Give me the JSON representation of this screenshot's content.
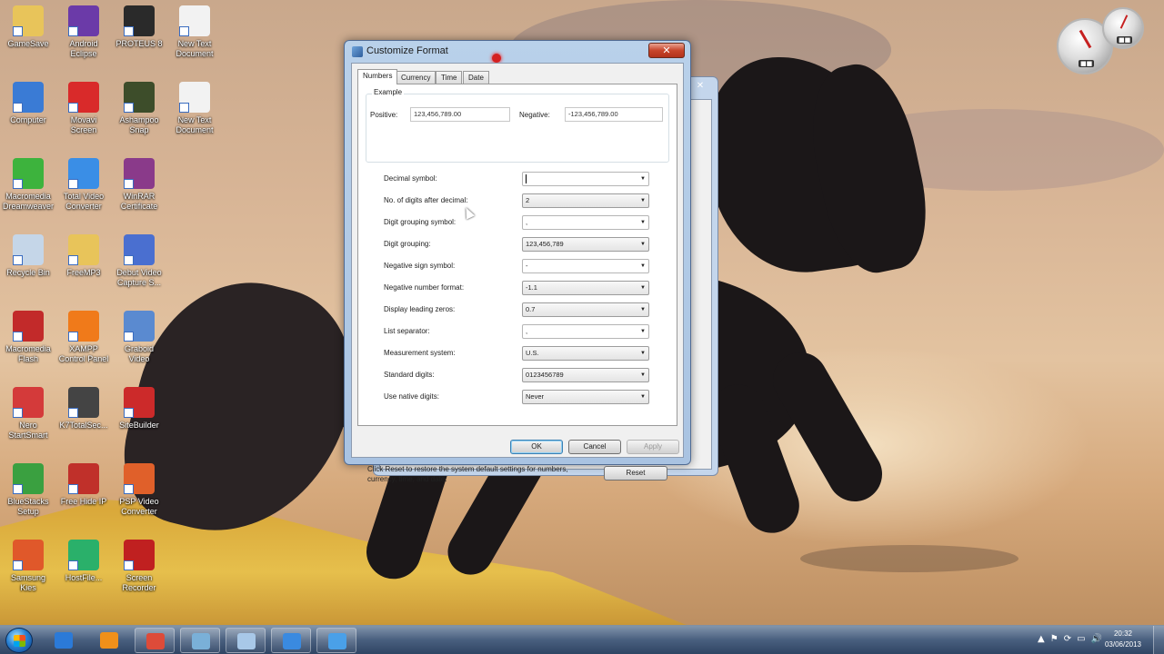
{
  "dialog": {
    "title": "Customize Format",
    "close_label": "✕",
    "tabs": [
      {
        "label": "Numbers"
      },
      {
        "label": "Currency"
      },
      {
        "label": "Time"
      },
      {
        "label": "Date"
      }
    ],
    "example": {
      "group_title": "Example",
      "positive_label": "Positive:",
      "positive_value": "123,456,789.00",
      "negative_label": "Negative:",
      "negative_value": "-123,456,789.00"
    },
    "fields": [
      {
        "label": "Decimal symbol:",
        "value": ""
      },
      {
        "label": "No. of digits after decimal:",
        "value": "2"
      },
      {
        "label": "Digit grouping symbol:",
        "value": ","
      },
      {
        "label": "Digit grouping:",
        "value": "123,456,789"
      },
      {
        "label": "Negative sign symbol:",
        "value": "-"
      },
      {
        "label": "Negative number format:",
        "value": "-1.1"
      },
      {
        "label": "Display leading zeros:",
        "value": "0.7"
      },
      {
        "label": "List separator:",
        "value": ","
      },
      {
        "label": "Measurement system:",
        "value": "U.S."
      },
      {
        "label": "Standard digits:",
        "value": "0123456789"
      },
      {
        "label": "Use native digits:",
        "value": "Never"
      }
    ],
    "reset_note": "Click Reset to restore the system default settings for numbers, currency, time, and date.",
    "reset_label": "Reset",
    "ok_label": "OK",
    "cancel_label": "Cancel",
    "apply_label": "Apply"
  },
  "desktop_icons": [
    {
      "label": "GameSave",
      "icon": "folder-icon",
      "color": "#e8c45a"
    },
    {
      "label": "Android\nEclipse",
      "icon": "eclipse-icon",
      "color": "#6b3aa8"
    },
    {
      "label": "PROTEUS 8",
      "icon": "proteus-icon",
      "color": "#2a2a2a"
    },
    {
      "label": "New Text\nDocument",
      "icon": "text-document-icon",
      "color": "#f2f2f2"
    },
    {
      "label": "Computer",
      "icon": "computer-icon",
      "color": "#3a7bd5"
    },
    {
      "label": "Movavi\nScreen",
      "icon": "movavi-icon",
      "color": "#d92a2a"
    },
    {
      "label": "Ashampoo\nSnap",
      "icon": "film-icon",
      "color": "#3d4d2a"
    },
    {
      "label": "New Text\nDocument",
      "icon": "text-document-icon",
      "color": "#f2f2f2"
    },
    {
      "label": "Macromedia\nDreamweaver",
      "icon": "dreamweaver-icon",
      "color": "#3db33d"
    },
    {
      "label": "Total Video\nConverter",
      "icon": "video-converter-icon",
      "color": "#3a8ee6"
    },
    {
      "label": "WinRAR\nCertificate",
      "icon": "winrar-icon",
      "color": "#8a3a8a"
    },
    {
      "label": "Recycle Bin",
      "icon": "recycle-bin-icon",
      "color": "#c5d6e8"
    },
    {
      "label": "FreeMP3",
      "icon": "folder-icon",
      "color": "#e8c45a"
    },
    {
      "label": "Debut Video\nCapture S...",
      "icon": "debut-capture-icon",
      "color": "#4a6fd0"
    },
    {
      "label": "Macromedia\nFlash",
      "icon": "flash-icon",
      "color": "#c22a2a"
    },
    {
      "label": "XAMPP\nControl Panel",
      "icon": "xampp-icon",
      "color": "#f07a1a"
    },
    {
      "label": "Graboid\nVideo",
      "icon": "graboid-icon",
      "color": "#5a8ad0"
    },
    {
      "label": "Nero\nStartSmart",
      "icon": "nero-icon",
      "color": "#d43a3a"
    },
    {
      "label": "K7TotalSec...",
      "icon": "k7-icon",
      "color": "#444444"
    },
    {
      "label": "SiteBuilder",
      "icon": "sitebuilder-icon",
      "color": "#cc2a2a"
    },
    {
      "label": "BlueStacks\nSetup",
      "icon": "bluestacks-icon",
      "color": "#3aa040"
    },
    {
      "label": "Free Hide IP",
      "icon": "hide-ip-icon",
      "color": "#c0302a"
    },
    {
      "label": "PSP Video\nConverter",
      "icon": "psp-converter-icon",
      "color": "#e0602a"
    },
    {
      "label": "Samsung\nKies",
      "icon": "kies-icon",
      "color": "#e0582a"
    },
    {
      "label": "HostFile...",
      "icon": "hostfile-icon",
      "color": "#2ab06a"
    },
    {
      "label": "Screen Recorder",
      "icon": "joystick-icon",
      "color": "#c02020"
    }
  ],
  "taskbar": {
    "apps": [
      {
        "icon": "internet-explorer-icon",
        "color": "#2b7ad8"
      },
      {
        "icon": "media-player-icon",
        "color": "#f0901a"
      },
      {
        "icon": "chrome-icon",
        "color": "#dd4b39"
      },
      {
        "icon": "window-switch-icon",
        "color": "#7ab0d8"
      },
      {
        "icon": "floppy-icon",
        "color": "#a8c8e8"
      },
      {
        "icon": "network-icon",
        "color": "#3a8ae0"
      },
      {
        "icon": "control-panel-icon",
        "color": "#4aa0e8"
      }
    ],
    "tray_icons": [
      "▲",
      "⚑",
      "⟳",
      "▭",
      "🔊"
    ],
    "time": "20:32",
    "date": "03/06/2013"
  }
}
